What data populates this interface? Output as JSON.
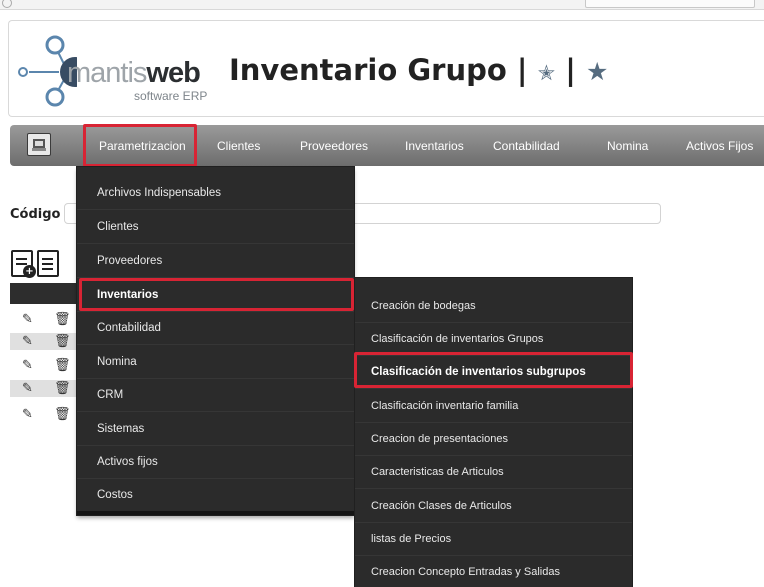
{
  "header": {
    "logo_text_thin": "mantis",
    "logo_text_bold": "web",
    "logo_subtext": "software ERP",
    "title": "Inventario Grupo |",
    "title_sep2": "|",
    "star_icons": [
      "star-icon",
      "star-icon"
    ]
  },
  "navbar": {
    "home_icon": "home-icon",
    "items": [
      {
        "label": "Parametrizacion",
        "selected": true
      },
      {
        "label": "Clientes"
      },
      {
        "label": "Proveedores"
      },
      {
        "label": "Inventarios"
      },
      {
        "label": "Contabilidad"
      },
      {
        "label": "Nomina"
      },
      {
        "label": "Activos Fijos"
      }
    ]
  },
  "form": {
    "codigo_label": "Código"
  },
  "toolbar": {
    "icons": [
      "new-document-icon",
      "document-icon"
    ]
  },
  "table": {
    "row_icons": [
      "edit-icon",
      "delete-icon"
    ],
    "row_count": 5
  },
  "menu": {
    "items": [
      {
        "label": "Archivos Indispensables"
      },
      {
        "label": "Clientes"
      },
      {
        "label": "Proveedores"
      },
      {
        "label": "Inventarios",
        "selected": true
      },
      {
        "label": "Contabilidad"
      },
      {
        "label": "Nomina"
      },
      {
        "label": "CRM"
      },
      {
        "label": "Sistemas"
      },
      {
        "label": "Activos fijos"
      },
      {
        "label": "Costos"
      }
    ]
  },
  "submenu": {
    "items": [
      {
        "label": "Creación de bodegas"
      },
      {
        "label": "Clasificación de inventarios Grupos"
      },
      {
        "label": "Clasificación de inventarios subgrupos",
        "selected": true
      },
      {
        "label": "Clasificación inventario familia"
      },
      {
        "label": "Creacion de presentaciones"
      },
      {
        "label": "Caracteristicas de Articulos"
      },
      {
        "label": "Creación Clases de Articulos"
      },
      {
        "label": "listas de Precios"
      },
      {
        "label": "Creacion Concepto Entradas y Salidas"
      }
    ]
  },
  "colors": {
    "highlight_red": "#d82434",
    "menu_bg": "#2b2b2b",
    "navbar_top": "#9a9a9a",
    "navbar_bottom": "#6d6d6d",
    "star_color": "#566c80"
  }
}
